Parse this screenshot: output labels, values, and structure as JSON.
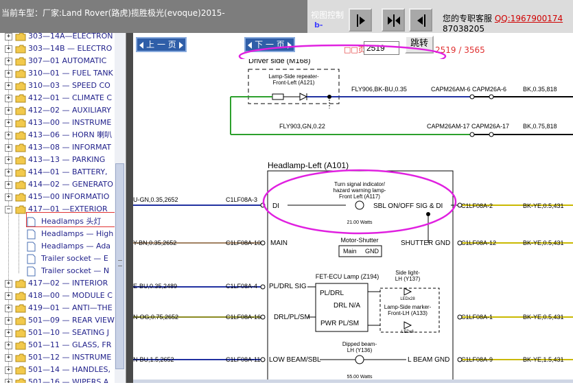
{
  "header": {
    "vehicle_title": "当前车型：厂家:Land Rover(路虎)揽胜极光(evoque)2015-",
    "view_control_label": "视图控制",
    "view_glyph": "b-",
    "service_label": "您的专职客服",
    "service_qq": "QQ:1967900174",
    "phone": "87038205"
  },
  "sidebar": {
    "items": [
      {
        "label": "303—14A—ELECTRON",
        "type": "folder"
      },
      {
        "label": "303—14B — ELECTRO",
        "type": "folder"
      },
      {
        "label": "307—01 AUTOMATIC",
        "type": "folder"
      },
      {
        "label": "310—01 — FUEL TANK",
        "type": "folder"
      },
      {
        "label": "310—03 — SPEED CO",
        "type": "folder"
      },
      {
        "label": "412—01 — CLIMATE C",
        "type": "folder"
      },
      {
        "label": "412—02 — AUXILIARY",
        "type": "folder"
      },
      {
        "label": "413—00 — INSTRUME",
        "type": "folder"
      },
      {
        "label": "413—06 — HORN 喇叭",
        "type": "folder"
      },
      {
        "label": "413—08 — INFORMAT",
        "type": "folder"
      },
      {
        "label": "413—13 — PARKING",
        "type": "folder"
      },
      {
        "label": "414—01 — BATTERY,",
        "type": "folder"
      },
      {
        "label": "414—02 — GENERATO",
        "type": "folder"
      },
      {
        "label": "415—00 INFORMATIO",
        "type": "folder"
      },
      {
        "label": "417—01 —EXTERIOR",
        "type": "folder-open"
      },
      {
        "label": "Headlamps 头灯",
        "type": "leaf"
      },
      {
        "label": "Headlamps — High",
        "type": "leaf"
      },
      {
        "label": "Headlamps — Ada",
        "type": "leaf"
      },
      {
        "label": "Trailer socket — E",
        "type": "leaf"
      },
      {
        "label": "Trailer socket — N",
        "type": "leaf"
      },
      {
        "label": "417—02 — INTERIOR",
        "type": "folder"
      },
      {
        "label": "418—00 — MODULE C",
        "type": "folder"
      },
      {
        "label": "419—01 — ANTI—THE",
        "type": "folder"
      },
      {
        "label": "501—09 — REAR VIEW",
        "type": "folder"
      },
      {
        "label": "501—10 — SEATING J",
        "type": "folder"
      },
      {
        "label": "501—11 — GLASS, FR",
        "type": "folder"
      },
      {
        "label": "501—12 — INSTRUME",
        "type": "folder"
      },
      {
        "label": "501—14 — HANDLES,",
        "type": "folder"
      },
      {
        "label": "501—16 — WIPERS A",
        "type": "folder"
      }
    ]
  },
  "nav": {
    "prev_label": "上 一 页",
    "next_label": "下 一 页",
    "page_label": "□□页",
    "page_value": "2519",
    "goto_label": "跳转",
    "page_count": "2519 / 3565"
  },
  "diagram": {
    "driver_side": "Driver side (M168)",
    "repeater_label1": "Lamp-Side repeater-",
    "repeater_label2": "Front-Left (A121)",
    "wire_fly906": "FLY906,BK-BU,0.35",
    "wire_fly903": "FLY903,GN,0.22",
    "capm6": "CAPM26AM-6 CAPM26A-6",
    "capm17": "CAPM26AM-17 CAPM26A-17",
    "wire_bk035": "BK,0.35,818",
    "wire_bk075": "BK,0.75,818",
    "headlamp_title": "Headlamp-Left (A101)",
    "turn_label1": "Turn signal indicator/",
    "turn_label2": "hazard warning lamp-",
    "turn_label3": "Front Left (A117)",
    "watts21": "21.00 Watts",
    "watts55": "55.00 Watts",
    "row1_left": "U-GN,0.35,2652",
    "row1_pin": "C1LF08A-3",
    "row1_func": "DI",
    "row1_right_func": "SBL ON/OFF SIG & DI",
    "row1_rpin": "C1LF08A-2",
    "row1_rwire": "BK-YE,0.5,431",
    "row2_left": "Y-BN,0.35,2652",
    "row2_pin": "C1LF08A-10",
    "row2_func": "MAIN",
    "motor_label": "Motor-Shutter",
    "motor_main": "Main",
    "motor_gnd": "GND",
    "row2_right_func": "SHUTTER GND",
    "row2_rpin": "C1LF08A-12",
    "row2_rwire": "BK-YE,0.5,431",
    "fet_label": "FET-ECU Lamp (Z194)",
    "row3_left": "E-BU,0.35,2489",
    "row3_pin": "C1LF08A-4",
    "row3_func": "PL/DRL SIG",
    "fet_pldrl": "PL/DRL",
    "fet_drlna": "DRL N/A",
    "fet_pwr": "PWR PL/SM",
    "side_light1": "Side light-",
    "side_light2": "LH (Y137)",
    "ledx28": "LEDx28",
    "marker1": "Lamp-Side marker-",
    "marker2": "Front-LH (A133)",
    "ledx6": "LEDx6",
    "row4_left": "N-OG,0.75,2652",
    "row4_pin": "C1LF08A-16",
    "row4_func": "DRL/PL/SM",
    "row4_rpin": "C1LF08A-1",
    "row4_rwire": "BK-YE,0.5,431",
    "dipped1": "Dipped beam-",
    "dipped2": "LH (Y136)",
    "row5_left": "N-BU,1.5,2652",
    "row5_pin": "C1LF08A-11",
    "row5_func": "LOW BEAM/SBL",
    "row5_right_func": "L BEAM GND",
    "row5_rpin": "C1LF08A-9",
    "row5_rwire": "BK-YE,1.5,431"
  },
  "colors": {
    "accent_magenta": "#e020e0",
    "green_wire": "#2ca02c",
    "yellow_wire": "#c9b800",
    "blue_wire": "#2030a0",
    "nav_blue": "#2f5ea8"
  }
}
